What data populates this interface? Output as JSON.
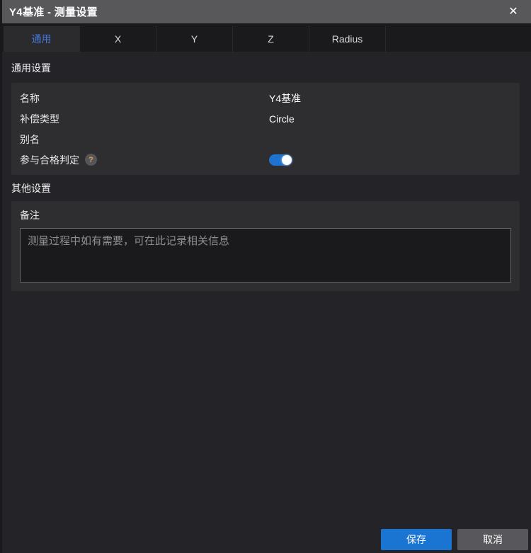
{
  "window": {
    "title": "Y4基准 - 测量设置",
    "close_icon": "✕"
  },
  "tabs": [
    {
      "label": "通用",
      "active": true
    },
    {
      "label": "X",
      "active": false
    },
    {
      "label": "Y",
      "active": false
    },
    {
      "label": "Z",
      "active": false
    },
    {
      "label": "Radius",
      "active": false
    }
  ],
  "general_section": {
    "title": "通用设置",
    "rows": [
      {
        "label": "名称",
        "value": "Y4基准"
      },
      {
        "label": "补偿类型",
        "value": "Circle"
      },
      {
        "label": "别名",
        "value": ""
      },
      {
        "label": "参与合格判定",
        "help_icon": "?",
        "toggle_on": true
      }
    ]
  },
  "other_section": {
    "title": "其他设置",
    "remark_label": "备注",
    "remark_placeholder": "测量过程中如有需要，可在此记录相关信息",
    "remark_value": ""
  },
  "footer": {
    "save_label": "保存",
    "cancel_label": "取消"
  },
  "colors": {
    "accent_blue": "#1a75d2",
    "toggle_blue": "#1e73cf",
    "active_tab_text": "#4678db",
    "titlebar_gray": "#58585b",
    "cancel_gray": "#58585c",
    "help_question_yellow": "#d7a64b"
  }
}
